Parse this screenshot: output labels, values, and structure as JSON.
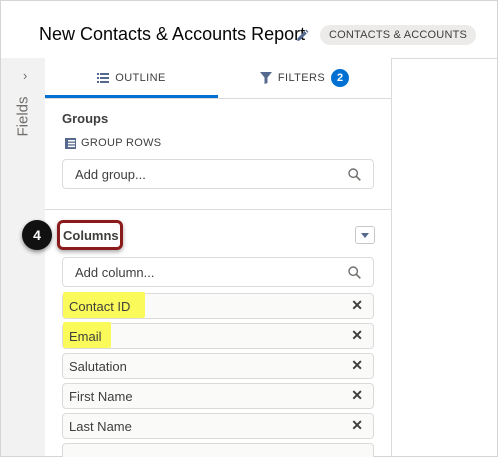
{
  "header": {
    "title": "New Contacts & Accounts Report",
    "report_type": "CONTACTS & ACCOUNTS"
  },
  "fields_rail": {
    "label": "Fields",
    "chevron": "›"
  },
  "tabs": [
    {
      "label": "OUTLINE",
      "icon": "list-icon",
      "active": true
    },
    {
      "label": "FILTERS",
      "icon": "filter-icon",
      "count": "2"
    }
  ],
  "groups": {
    "title": "Groups",
    "group_rows_label": "GROUP ROWS",
    "placeholder": "Add group..."
  },
  "columns": {
    "step_number": "4",
    "title": "Columns",
    "placeholder": "Add column...",
    "items": [
      {
        "label": "Contact ID",
        "highlighted": true
      },
      {
        "label": "Email",
        "highlighted": true
      },
      {
        "label": "Salutation",
        "highlighted": false
      },
      {
        "label": "First Name",
        "highlighted": false
      },
      {
        "label": "Last Name",
        "highlighted": false
      }
    ],
    "remove_glyph": "✕"
  },
  "colors": {
    "accent": "#0070d2",
    "highlight": "#fafa5a",
    "callout_border": "#8b1b1b"
  }
}
